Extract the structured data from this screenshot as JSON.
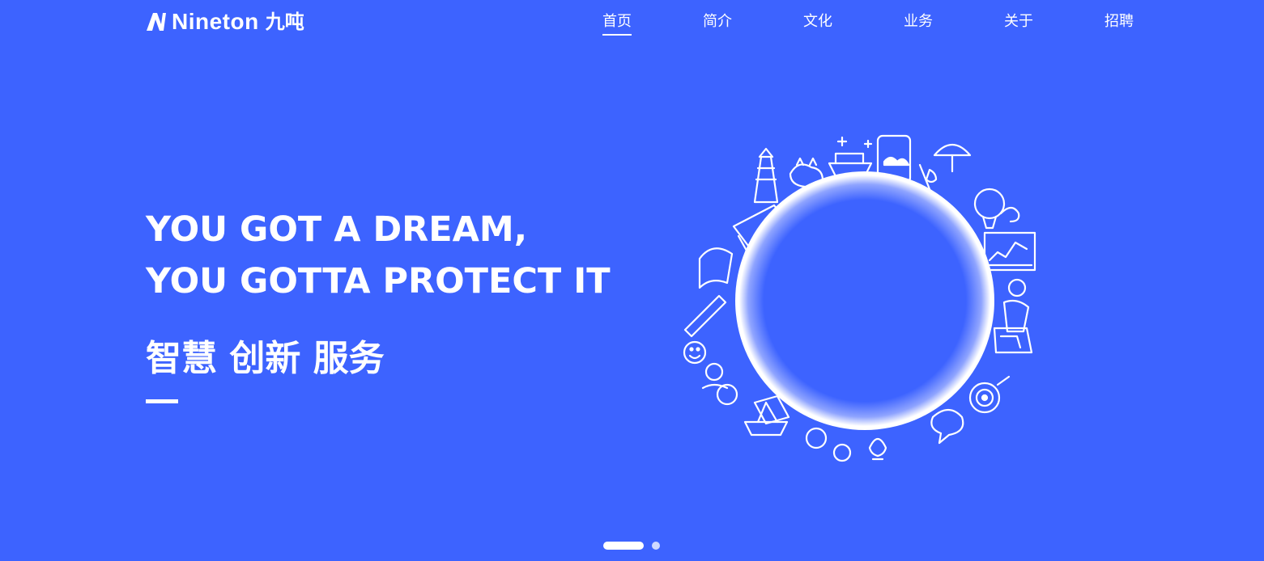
{
  "colors": {
    "background": "#3d63ff",
    "foreground": "#ffffff"
  },
  "header": {
    "logo": {
      "latin": "Nineton",
      "cn": "九吨",
      "icon": "logo-n-icon"
    },
    "nav": [
      {
        "label": "首页",
        "active": true
      },
      {
        "label": "简介",
        "active": false
      },
      {
        "label": "文化",
        "active": false
      },
      {
        "label": "业务",
        "active": false
      },
      {
        "label": "关于",
        "active": false
      },
      {
        "label": "招聘",
        "active": false
      }
    ]
  },
  "hero": {
    "headline_line1": "YOU GOT A DREAM,",
    "headline_line2": "YOU GOTTA PROTECT IT",
    "slogan": "智慧 创新 服务",
    "illustration": "doodle-globe-illustration"
  },
  "carousel": {
    "slide_count": 2,
    "active_index": 0
  }
}
